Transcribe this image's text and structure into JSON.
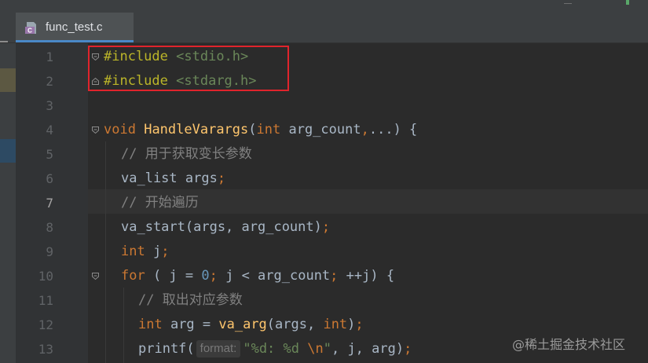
{
  "tab": {
    "label": "func_test.c",
    "icon_letter": "C",
    "close_glyph": "×"
  },
  "line_numbers": [
    "1",
    "2",
    "3",
    "4",
    "5",
    "6",
    "7",
    "8",
    "9",
    "10",
    "11",
    "12",
    "13"
  ],
  "current_line": "7",
  "code": {
    "l1": {
      "directive": "#include",
      "header": "<stdio.h>"
    },
    "l2": {
      "directive": "#include",
      "header": "<stdarg.h>"
    },
    "l4": {
      "kw_void": "void",
      "fn": "HandleVarargs",
      "open": "(",
      "kw_int": "int",
      "rest": " arg_count",
      "comma": ",",
      "dots": "...",
      "close": ") {"
    },
    "l5": {
      "comment": "// 用于获取变长参数"
    },
    "l6": {
      "text": "va_list args",
      "semi": ";"
    },
    "l7": {
      "comment": "// 开始遍历"
    },
    "l8": {
      "text": "va_start(args, arg_count)",
      "semi": ";"
    },
    "l9": {
      "kw": "int",
      "text": " j",
      "semi": ";"
    },
    "l10": {
      "kw": "for",
      "a": " ( j = ",
      "zero": "0",
      "semi1": ";",
      "b": " j < arg_count",
      "semi2": ";",
      "c": " ++j) {"
    },
    "l11": {
      "comment": "// 取出对应参数"
    },
    "l12": {
      "kw1": "int",
      "a": " arg = ",
      "fn": "va_arg",
      "b": "(args, ",
      "kw2": "int",
      "c": ")",
      "semi": ";"
    },
    "l13": {
      "a": "printf(",
      "hint": "format:",
      "str1": "\"%d: %d ",
      "esc": "\\n",
      "str2": "\"",
      "b": ", j, arg)",
      "semi": ";"
    }
  },
  "watermark": "@稀土掘金技术社区",
  "colors": {
    "editor_bg": "#2b2b2b",
    "keyword": "#cc7832",
    "preprocessor": "#bbb529",
    "string": "#6a8759",
    "function": "#ffc66d",
    "comment": "#808080",
    "number": "#6897bb",
    "annotation_box": "#e0242c",
    "tab_underline": "#4a88c7"
  }
}
